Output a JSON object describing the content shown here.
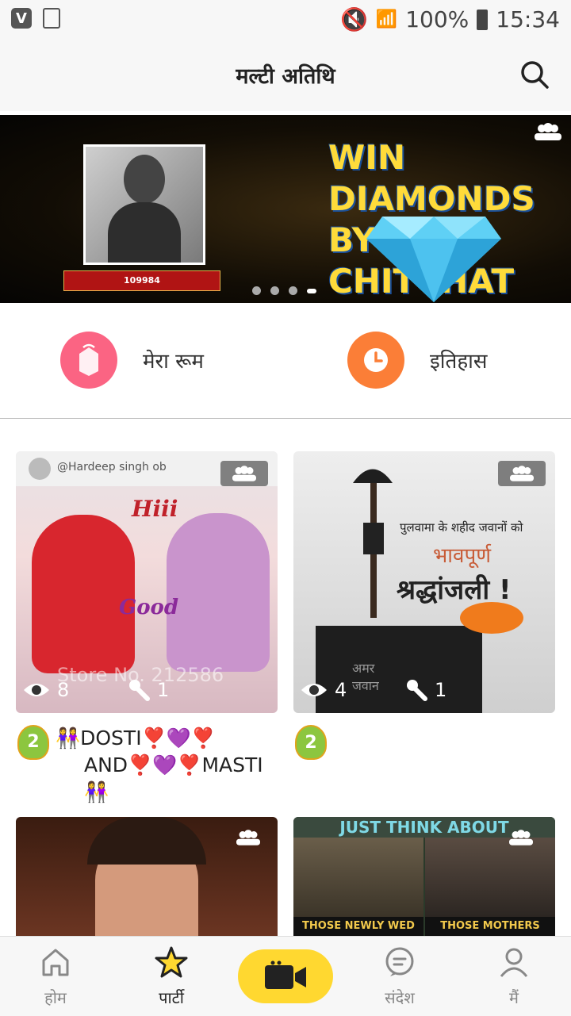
{
  "status_bar": {
    "battery": "100%",
    "time": "15:34"
  },
  "header": {
    "title": "मल्टी अतिथि"
  },
  "banner": {
    "headline_line1": "WIN DIAMONDS",
    "headline_line2": "BY CHITCHAT",
    "ribbon_id": "109984",
    "page_count": 4,
    "active_page": 4
  },
  "quick_actions": [
    {
      "label": "मेरा रूम",
      "icon": "room-icon",
      "color": "#fb6483"
    },
    {
      "label": "इतिहास",
      "icon": "clock-icon",
      "color": "#fb7e37"
    }
  ],
  "rooms": [
    {
      "poster_text": "@Hardeep singh ob",
      "caption_top": "Hiii",
      "caption_mid": "Good",
      "watermark": "Store No. 212586",
      "viewers": "8",
      "mics": "1",
      "level": "2",
      "title_line1": "👭DOSTI❣️💜❣️",
      "title_line2": "AND❣️💜❣️MASTI👭"
    },
    {
      "poster_text": "पुलवामा के शहीद जवानों को",
      "caption_top": "भावपूर्ण",
      "caption_mid": "श्रद्धांजली !",
      "plinth_text": "अमर जवान",
      "viewers": "4",
      "mics": "1",
      "level": "2"
    },
    {
      "viewers": "",
      "mics": ""
    },
    {
      "poster_text": "JUST THINK ABOUT",
      "caption_left": "THOSE NEWLY WED",
      "caption_right": "THOSE MOTHERS WHO"
    }
  ],
  "tabs": [
    {
      "label": "होम",
      "icon": "home-icon"
    },
    {
      "label": "पार्टी",
      "icon": "star-icon",
      "active": true
    },
    {
      "label": "",
      "icon": "video-camera-icon"
    },
    {
      "label": "संदेश",
      "icon": "chat-icon"
    },
    {
      "label": "मैं",
      "icon": "profile-icon"
    }
  ],
  "colors": {
    "accent": "#ffd830",
    "banner_headline": "#ffdb3a"
  }
}
